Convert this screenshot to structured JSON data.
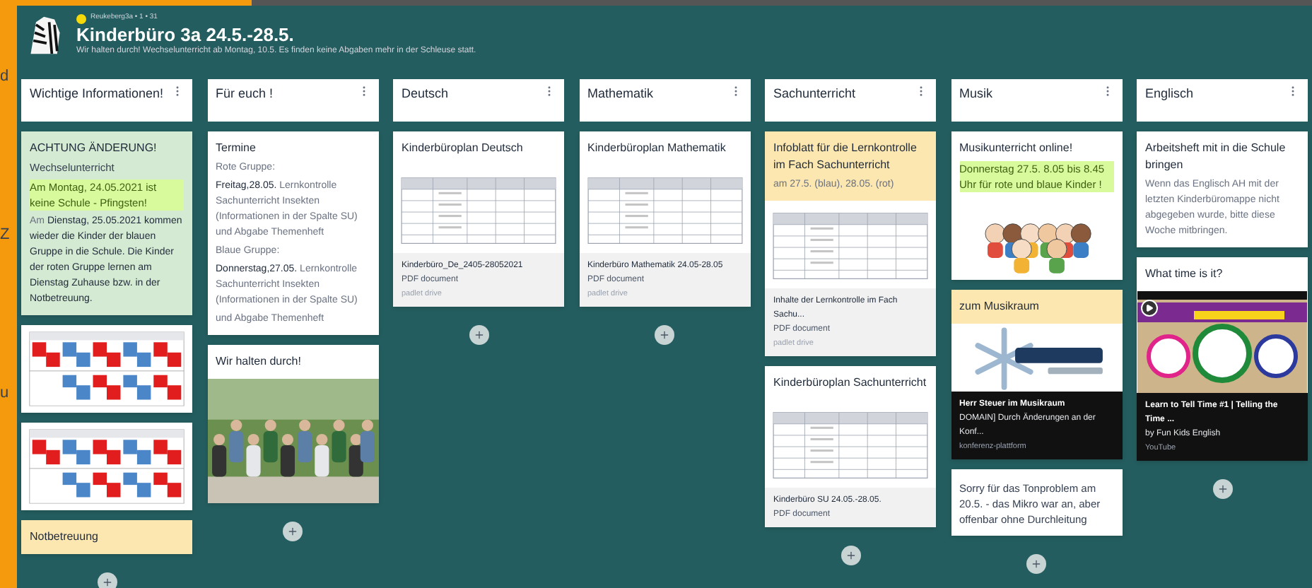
{
  "background_window": {
    "fragments": [
      "d",
      "Z",
      "u"
    ]
  },
  "board": {
    "author": "Reukeberg3a • 1 • 31",
    "title": "Kinderbüro 3a 24.5.-28.5.",
    "description": "Wir halten durch! Wechselunterricht ab Montag, 10.5. Es finden keine Abgaben mehr in der Schleuse statt."
  },
  "columns": [
    {
      "title": "Wichtige Informationen!",
      "posts": [
        {
          "color": "#d5ead2",
          "title": "ACHTUNG ÄNDERUNG!",
          "body": [
            {
              "kind": "subtitle",
              "text": "Wechselunterricht"
            },
            {
              "kind": "highlight",
              "text": "Am Montag, 24.05.2021 ist keine Schule - Pfingsten!"
            },
            {
              "kind": "text",
              "text": "Am **Dienstag, 25.05.2021 kommen wieder die Kinder der blauen Gruppe in die Schule. Die Kinder der roten Gruppe lernen am Dienstag Zuhause bzw. in der Notbetreuung.**"
            }
          ]
        },
        {
          "color": "#ffffff",
          "attachment": {
            "kind": "timetable"
          }
        },
        {
          "color": "#ffffff",
          "attachment": {
            "kind": "timetable"
          }
        },
        {
          "color": "#fde7b0",
          "title": "Notbetreuung"
        }
      ]
    },
    {
      "title": "Für euch !",
      "posts": [
        {
          "color": "#ffffff",
          "title": "Termine",
          "body": [
            {
              "kind": "text",
              "text": "Rote Gruppe:"
            },
            {
              "kind": "text",
              "text": "**Freitag,28.05.** Lernkontrolle Sachunterricht Insekten (Informationen in der Spalte SU) und Abgabe Themenheft"
            },
            {
              "kind": "text",
              "text": "Blaue Gruppe:"
            },
            {
              "kind": "text",
              "text": "**Donnerstag,27.05.** Lernkontrolle Sachunterricht Insekten (Informationen in der Spalte SU)"
            },
            {
              "kind": "text",
              "text": "und Abgabe Themenheft"
            }
          ]
        },
        {
          "color": "#ffffff",
          "title": "Wir halten durch!"
        }
      ]
    },
    {
      "title": "Deutsch",
      "posts": [
        {
          "color": "#ffffff",
          "title": "Kinderbüroplan Deutsch",
          "attachment": {
            "kind": "document",
            "name": "Kinderbüro_De_2405-28052021",
            "type": "PDF document",
            "source": "padlet drive"
          }
        }
      ]
    },
    {
      "title": "Mathematik",
      "posts": [
        {
          "color": "#ffffff",
          "title": "Kinderbüroplan Mathematik",
          "attachment": {
            "kind": "document",
            "name": "Kinderbüro Mathematik 24.05-28.05",
            "type": "PDF document",
            "source": "padlet drive"
          }
        }
      ]
    },
    {
      "title": "Sachunterricht",
      "posts": [
        {
          "color": "#fde7b0",
          "title": "Infoblatt für die Lernkontrolle im Fach Sachunterricht",
          "body": [
            {
              "kind": "text",
              "text": "am 27.5. (blau), 28.05. (rot)"
            }
          ],
          "attachment": {
            "kind": "document",
            "name": "Inhalte der Lernkontrolle im Fach Sachu...",
            "type": "PDF document",
            "source": "padlet drive"
          }
        },
        {
          "color": "#ffffff",
          "title": "Kinderbüroplan Sachunterricht",
          "attachment": {
            "kind": "document",
            "name": "Kinderbüro SU 24.05.-28.05.",
            "type": "PDF document"
          }
        }
      ]
    },
    {
      "title": "Musik",
      "posts": [
        {
          "color": "#ffffff",
          "title": "Musikunterricht online!",
          "body": [
            {
              "kind": "highlight",
              "text": "Donnerstag 27.5. 8.05 bis 8.45 Uhr für rote und blaue Kinder !"
            }
          ],
          "attachment": {
            "kind": "illustration"
          }
        },
        {
          "color": "#fde7b0",
          "title": "zum Musikraum",
          "attachment": {
            "kind": "link",
            "name": "Herr Steuer im Musikraum",
            "type": "DOMAIN] Durch Änderungen an der Konf...",
            "source": "konferenz-plattform"
          }
        },
        {
          "color": "#ffffff",
          "body": [
            {
              "kind": "subtitle",
              "text": "Sorry für das Tonproblem am 20.5. - das Mikro war an, aber offenbar ohne Durchleitung"
            }
          ]
        }
      ]
    },
    {
      "title": "Englisch",
      "posts": [
        {
          "color": "#ffffff",
          "title": "Arbeitsheft mit in die Schule bringen",
          "body": [
            {
              "kind": "text",
              "text": "Wenn das Englisch AH mit der letzten Kinderbüromappe nicht abgegeben wurde, bitte diese Woche mitbringen."
            }
          ]
        },
        {
          "color": "#ffffff",
          "title": "What time is it?",
          "attachment": {
            "kind": "video",
            "name": "Learn to Tell Time #1 | Telling the Time ...",
            "type": "by Fun Kids English",
            "source": "YouTube"
          }
        }
      ]
    }
  ]
}
